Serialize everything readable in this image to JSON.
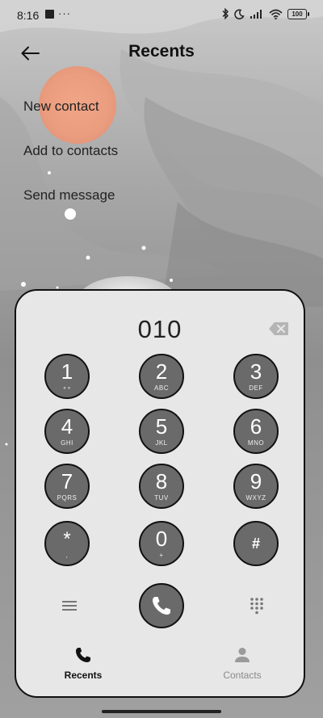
{
  "status_bar": {
    "time": "8:16",
    "dots": "···",
    "battery": "100"
  },
  "header": {
    "title": "Recents"
  },
  "menu": {
    "items": [
      {
        "label": "New contact"
      },
      {
        "label": "Add to contacts"
      },
      {
        "label": "Send message"
      }
    ]
  },
  "dialer": {
    "number": "010",
    "keys": [
      {
        "digit": "1",
        "letters": "∘∘"
      },
      {
        "digit": "2",
        "letters": "ABC"
      },
      {
        "digit": "3",
        "letters": "DEF"
      },
      {
        "digit": "4",
        "letters": "GHI"
      },
      {
        "digit": "5",
        "letters": "JKL"
      },
      {
        "digit": "6",
        "letters": "MNO"
      },
      {
        "digit": "7",
        "letters": "PQRS"
      },
      {
        "digit": "8",
        "letters": "TUV"
      },
      {
        "digit": "9",
        "letters": "WXYZ"
      },
      {
        "digit": "*",
        "letters": ","
      },
      {
        "digit": "0",
        "letters": "+"
      },
      {
        "digit": "#",
        "letters": ""
      }
    ]
  },
  "tabs": {
    "recents_label": "Recents",
    "contacts_label": "Contacts"
  },
  "colors": {
    "key_fill": "#6a6a6a",
    "sheet_bg": "#e7e7e7",
    "accent_peach": "#f0a080"
  },
  "icons": {
    "back": "arrow-left-icon",
    "backspace": "backspace-icon",
    "call": "phone-icon",
    "menu": "menu-lines-icon",
    "dialpad": "dialpad-icon",
    "recents": "phone-recents-icon",
    "contacts": "person-icon"
  }
}
